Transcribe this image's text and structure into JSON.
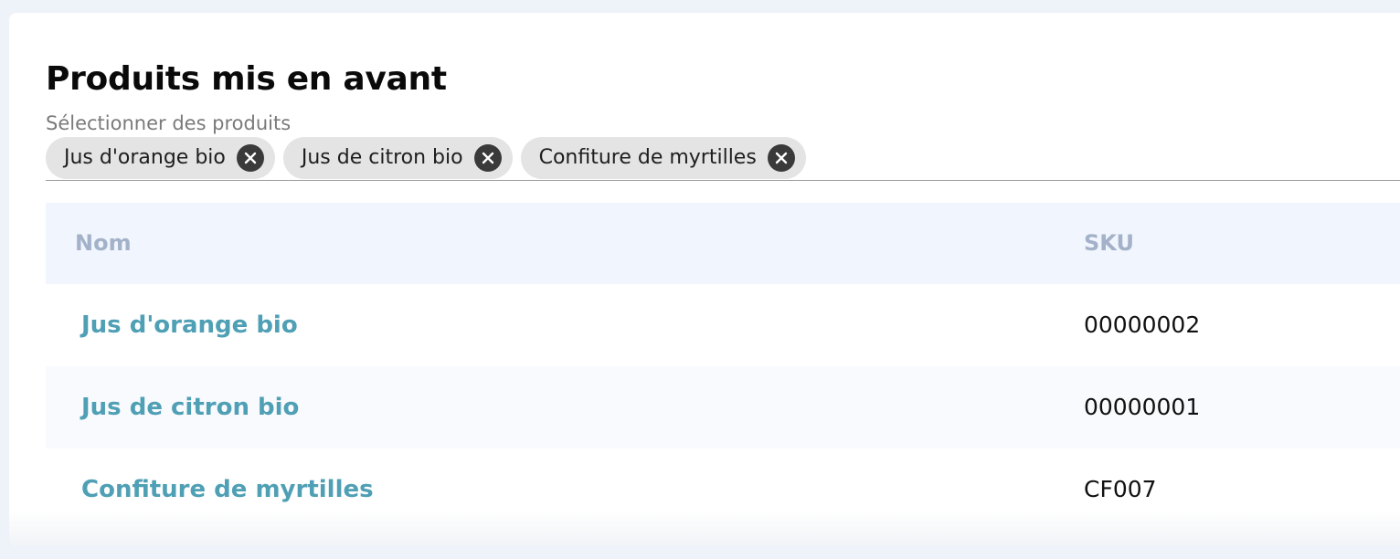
{
  "section": {
    "title": "Produits mis en avant",
    "select_label": "Sélectionner des produits",
    "selected_chips": [
      {
        "label": "Jus d'orange bio",
        "remove_icon": "close-circle-icon"
      },
      {
        "label": "Jus de citron bio",
        "remove_icon": "close-circle-icon"
      },
      {
        "label": "Confiture de myrtilles",
        "remove_icon": "close-circle-icon"
      }
    ]
  },
  "table": {
    "columns": [
      "Nom",
      "SKU"
    ],
    "rows": [
      {
        "name": "Jus d'orange bio",
        "sku": "00000002"
      },
      {
        "name": "Jus de citron bio",
        "sku": "00000001"
      },
      {
        "name": "Confiture de myrtilles",
        "sku": "CF007"
      }
    ]
  },
  "colors": {
    "link": "#4f9fb5",
    "header_text": "#a3b2c9",
    "header_bg": "#f1f5fd",
    "chip_bg": "#e4e4e4"
  }
}
